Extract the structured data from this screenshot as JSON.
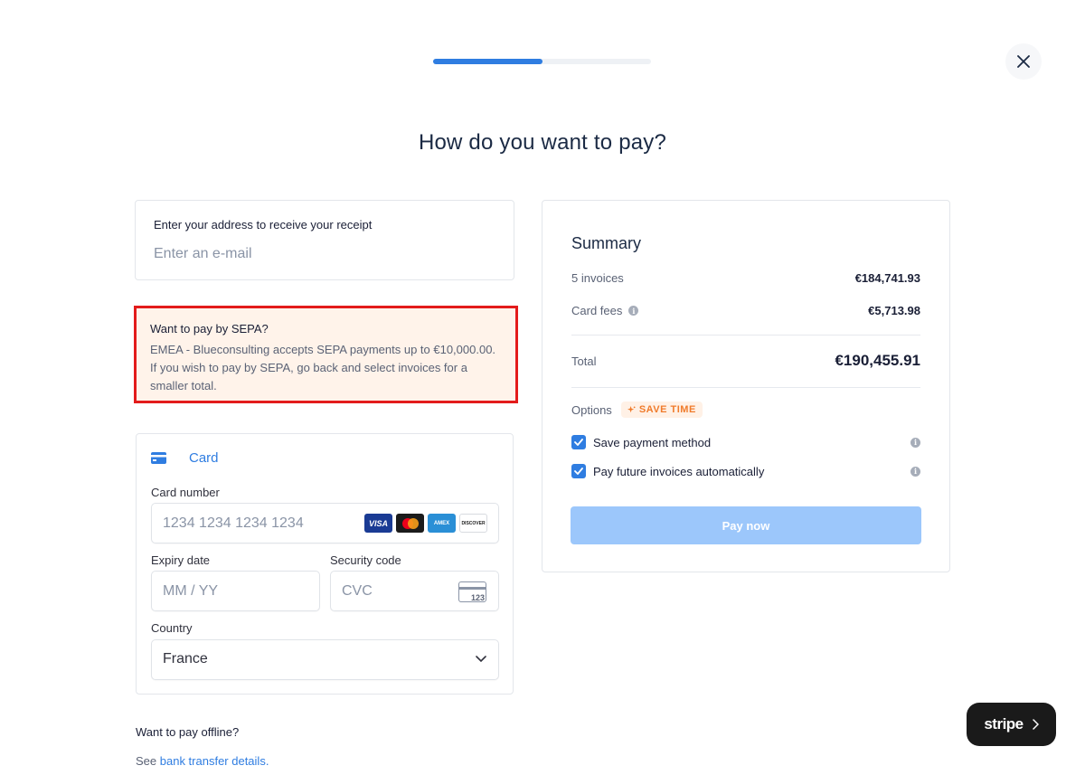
{
  "progress": {
    "fraction": 0.5
  },
  "header": {
    "title": "How do you want to pay?"
  },
  "email": {
    "label": "Enter your address to receive your receipt",
    "placeholder": "Enter an e-mail"
  },
  "sepa_notice": {
    "title": "Want to pay by SEPA?",
    "text": "EMEA - Blueconsulting accepts SEPA payments up to €10,000.00. If you wish to pay by SEPA, go back and select invoices for a smaller total."
  },
  "card_form": {
    "tab_label": "Card",
    "card_number_label": "Card number",
    "card_number_placeholder": "1234 1234 1234 1234",
    "brands": [
      "VISA",
      "Mastercard",
      "AMEX",
      "DISCOVER"
    ],
    "expiry_label": "Expiry date",
    "expiry_placeholder": "MM / YY",
    "security_label": "Security code",
    "security_placeholder": "CVC",
    "cvc_hint": "123",
    "country_label": "Country",
    "country_value": "France"
  },
  "offline": {
    "title": "Want to pay offline?",
    "prefix": "See ",
    "link": "bank transfer details."
  },
  "summary": {
    "title": "Summary",
    "invoices_label": "5 invoices",
    "invoices_value": "€184,741.93",
    "fees_label": "Card fees",
    "fees_value": "€5,713.98",
    "total_label": "Total",
    "total_value": "€190,455.91",
    "options_label": "Options",
    "badge": "SAVE TIME",
    "option_save": "Save payment method",
    "option_autopay": "Pay future invoices automatically",
    "pay_button": "Pay now"
  },
  "stripe": {
    "label": "stripe"
  },
  "colors": {
    "accent": "#2f7de1",
    "highlight_border": "#e31b1b",
    "notice_bg": "#fff3ea",
    "pay_button_disabled": "#9cc7fb"
  }
}
